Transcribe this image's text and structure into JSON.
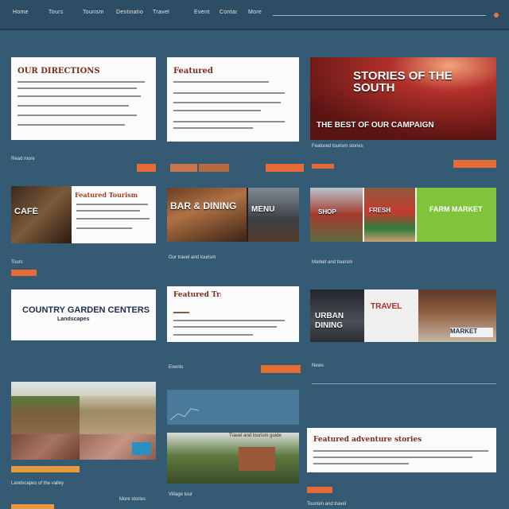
{
  "nav": {
    "items": [
      "Home",
      "Tours",
      "Tourism",
      "Destinations",
      "Travel",
      "Events",
      "Contact"
    ]
  },
  "cards": {
    "c1": {
      "title": "OUR DIRECTIONS",
      "button": ""
    },
    "c2": {
      "title": "Featured",
      "button": ""
    },
    "c3": {
      "headline": "STORIES OF THE SOUTH",
      "subline": "THE BEST OF OUR CAMPAIGN",
      "caption": "Featured tourism stories",
      "button": ""
    },
    "c4": {
      "banner": "Featured Tourism",
      "caption": "Our travel and tourism"
    },
    "c5": {
      "title": "COUNTRY GARDEN CENTERS",
      "sub": "Landscapes"
    },
    "c6": {
      "title": "Featured Travel",
      "caption": "Events",
      "button": ""
    },
    "c7": {
      "label": "TRAVEL",
      "caption": "Travel and tourism guide"
    },
    "c8": {
      "label": "MARKET",
      "caption": "News"
    },
    "c9": {
      "title": "Featured adventure stories",
      "caption": "Tourism and travel"
    }
  },
  "colors": {
    "background": "#355a73",
    "accent": "#e56b37",
    "card": "#fbfbfb"
  }
}
